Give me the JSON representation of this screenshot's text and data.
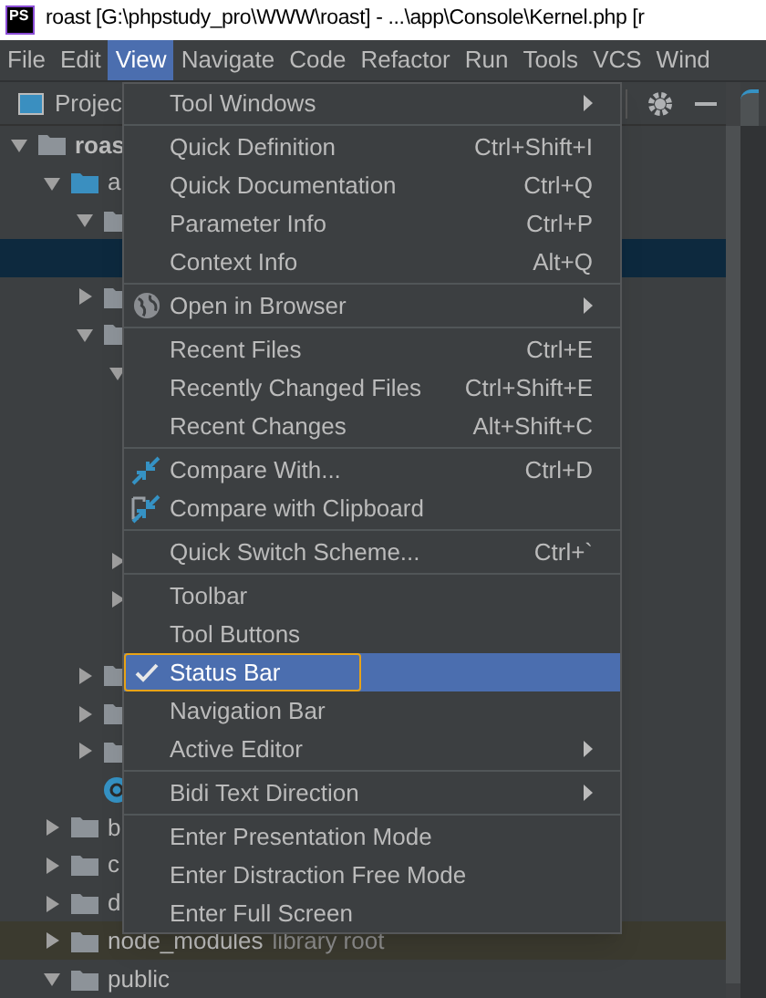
{
  "window": {
    "logo": "PS",
    "title": "roast [G:\\phpstudy_pro\\WWW\\roast] - ...\\app\\Console\\Kernel.php [r"
  },
  "menu_bar": [
    {
      "label": "File",
      "selected": false
    },
    {
      "label": "Edit",
      "selected": false
    },
    {
      "label": "View",
      "selected": true
    },
    {
      "label": "Navigate",
      "selected": false
    },
    {
      "label": "Code",
      "selected": false
    },
    {
      "label": "Refactor",
      "selected": false
    },
    {
      "label": "Run",
      "selected": false
    },
    {
      "label": "Tools",
      "selected": false
    },
    {
      "label": "VCS",
      "selected": false
    },
    {
      "label": "Wind",
      "selected": false
    }
  ],
  "project_panel": {
    "title": "Projec"
  },
  "tree": [
    {
      "label": "roas",
      "kind": "root",
      "expanded": true,
      "selected": false,
      "children": [
        {
          "label": "a",
          "kind": "source_folder",
          "expanded": true,
          "selected": false,
          "children": [
            {
              "kind": "folder",
              "expanded": true,
              "selected": false,
              "children": [
                {
                  "selected": true
                }
              ]
            },
            {
              "kind": "folder",
              "expanded": false,
              "selected": false
            },
            {
              "kind": "folder",
              "expanded": true,
              "selected": false,
              "children": [
                {
                  "kind": "folder",
                  "expanded": true,
                  "selected": false,
                  "children": [
                    {
                      "selected": false
                    },
                    {
                      "selected": false
                    },
                    {
                      "selected": false
                    },
                    {
                      "selected": false
                    }
                  ]
                },
                {
                  "kind": "folder",
                  "expanded": false,
                  "selected": false
                },
                {
                  "kind": "folder",
                  "expanded": false,
                  "selected": false
                },
                {
                  "selected": false
                }
              ]
            },
            {
              "kind": "folder",
              "expanded": false,
              "selected": false
            },
            {
              "kind": "folder",
              "expanded": false,
              "selected": false
            },
            {
              "kind": "folder",
              "expanded": false,
              "selected": false
            },
            {
              "kind": "class_file",
              "selected": false
            }
          ]
        },
        {
          "label": "b",
          "kind": "folder",
          "expanded": false,
          "selected": false
        },
        {
          "label": "c",
          "kind": "folder",
          "expanded": false,
          "selected": false
        },
        {
          "label": "d",
          "kind": "folder",
          "expanded": false,
          "selected": false
        },
        {
          "label": "node_modules",
          "suffix": "library root",
          "kind": "library_folder",
          "expanded": false,
          "selected": false
        },
        {
          "label": "public",
          "kind": "folder",
          "expanded": true,
          "selected": false
        }
      ]
    }
  ],
  "view_menu": [
    {
      "kind": "submenu",
      "label": "Tool Windows",
      "selected": false
    },
    {
      "kind": "separator"
    },
    {
      "kind": "item",
      "label": "Quick Definition",
      "shortcut": "Ctrl+Shift+I",
      "selected": false
    },
    {
      "kind": "item",
      "label": "Quick Documentation",
      "shortcut": "Ctrl+Q",
      "selected": false
    },
    {
      "kind": "item",
      "label": "Parameter Info",
      "shortcut": "Ctrl+P",
      "selected": false
    },
    {
      "kind": "item",
      "label": "Context Info",
      "shortcut": "Alt+Q",
      "selected": false
    },
    {
      "kind": "separator"
    },
    {
      "kind": "browser",
      "label": "Open in Browser",
      "selected": false
    },
    {
      "kind": "separator"
    },
    {
      "kind": "item",
      "label": "Recent Files",
      "shortcut": "Ctrl+E",
      "selected": false
    },
    {
      "kind": "item",
      "label": "Recently Changed Files",
      "shortcut": "Ctrl+Shift+E",
      "selected": false
    },
    {
      "kind": "item",
      "label": "Recent Changes",
      "shortcut": "Alt+Shift+C",
      "selected": false
    },
    {
      "kind": "separator"
    },
    {
      "kind": "compare",
      "label": "Compare With...",
      "shortcut": "Ctrl+D",
      "selected": false
    },
    {
      "kind": "compare_clipboard",
      "label": "Compare with Clipboard",
      "selected": false
    },
    {
      "kind": "separator"
    },
    {
      "kind": "item",
      "label": "Quick Switch Scheme...",
      "shortcut": "Ctrl+`",
      "selected": false
    },
    {
      "kind": "separator"
    },
    {
      "kind": "toggle",
      "label": "Toolbar",
      "checked": false,
      "selected": false
    },
    {
      "kind": "toggle",
      "label": "Tool Buttons",
      "checked": false,
      "selected": false
    },
    {
      "kind": "toggle",
      "label": "Status Bar",
      "checked": true,
      "selected": true
    },
    {
      "kind": "toggle",
      "label": "Navigation Bar",
      "checked": false,
      "selected": false
    },
    {
      "kind": "submenu",
      "label": "Active Editor",
      "selected": false
    },
    {
      "kind": "separator"
    },
    {
      "kind": "submenu",
      "label": "Bidi Text Direction",
      "selected": false
    },
    {
      "kind": "separator"
    },
    {
      "kind": "item",
      "label": "Enter Presentation Mode",
      "selected": false
    },
    {
      "kind": "item",
      "label": "Enter Distraction Free Mode",
      "selected": false
    },
    {
      "kind": "item",
      "label": "Enter Full Screen",
      "selected": false
    }
  ]
}
